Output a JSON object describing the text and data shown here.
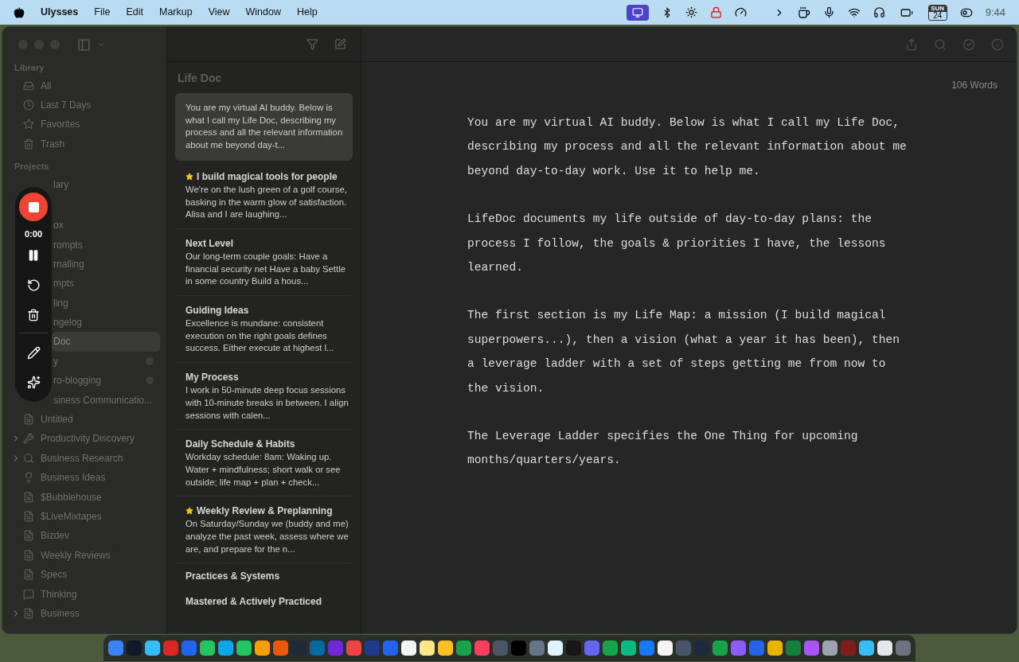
{
  "menu_bar": {
    "app": "Ulysses",
    "menus": [
      "File",
      "Edit",
      "Markup",
      "View",
      "Window",
      "Help"
    ],
    "calendar_day": "SUN",
    "calendar_date": "24",
    "clock": "9:44"
  },
  "sidebar": {
    "sections": [
      {
        "title": "Library",
        "items": [
          {
            "label": "All",
            "kind": "inbox",
            "selected": false
          },
          {
            "label": "Last 7 Days",
            "kind": "clock",
            "selected": false
          },
          {
            "label": "Favorites",
            "kind": "star",
            "selected": false
          },
          {
            "label": "Trash",
            "kind": "trash",
            "selected": false
          }
        ]
      },
      {
        "title": "Projects",
        "items": [
          {
            "label": "lary",
            "kind": "partial",
            "selected": false
          },
          {
            "label": "ox",
            "kind": "partial",
            "selected": false
          },
          {
            "label": "rompts",
            "kind": "partial",
            "selected": false
          },
          {
            "label": "rnalling",
            "kind": "partial",
            "selected": false
          },
          {
            "label": "mpts",
            "kind": "partial",
            "selected": false
          },
          {
            "label": "ling",
            "kind": "partial",
            "selected": false
          },
          {
            "label": "ngelog",
            "kind": "partial",
            "selected": false
          },
          {
            "label": "Doc",
            "kind": "partial",
            "selected": true
          },
          {
            "label": "y",
            "kind": "partial",
            "selected": false,
            "badge": true
          },
          {
            "label": "ro-blogging",
            "kind": "partial",
            "selected": false,
            "badge": true
          },
          {
            "label": "siness Communicatio...",
            "kind": "partial",
            "selected": false
          },
          {
            "label": "Untitled",
            "kind": "document",
            "selected": false
          },
          {
            "label": "Productivity Discovery",
            "kind": "tools",
            "selected": false,
            "expandable": true
          },
          {
            "label": "Business Research",
            "kind": "search",
            "selected": false,
            "expandable": true
          },
          {
            "label": "Business Ideas",
            "kind": "bulb",
            "selected": false
          },
          {
            "label": "$Bubblehouse",
            "kind": "document",
            "selected": false
          },
          {
            "label": "$LiveMixtapes",
            "kind": "document",
            "selected": false
          },
          {
            "label": "Bizdev",
            "kind": "document",
            "selected": false
          },
          {
            "label": "Weekly Reviews",
            "kind": "document",
            "selected": false
          },
          {
            "label": "Specs",
            "kind": "document",
            "selected": false
          },
          {
            "label": "Thinking",
            "kind": "chat",
            "selected": false
          },
          {
            "label": "Business",
            "kind": "document",
            "selected": false,
            "expandable": true
          }
        ]
      }
    ]
  },
  "recorder": {
    "time": "0:00"
  },
  "sheet_list": {
    "title": "Life Doc",
    "sheets": [
      {
        "starred": false,
        "selected": true,
        "preview": "You are my virtual AI buddy. Below is what I call my Life Doc, describing my process and all the relevant information about me beyond day-t..."
      },
      {
        "title": "I build magical tools for people",
        "starred": true,
        "selected": false,
        "preview": "We're on the lush green of a golf course, basking in the warm glow of satisfaction. Alisa and I are laughing..."
      },
      {
        "title": "Next Level",
        "starred": false,
        "selected": false,
        "preview": "Our long-term couple goals: Have a financial security net Have a baby Settle in some country Build a hous..."
      },
      {
        "title": "Guiding Ideas",
        "starred": false,
        "selected": false,
        "preview": "Excellence is mundane: consistent execution on the right goals defines success. Either execute at highest l..."
      },
      {
        "title": "My Process",
        "starred": false,
        "selected": false,
        "preview": "I work in 50-minute deep focus sessions with 10-minute breaks in between. I align sessions with calen..."
      },
      {
        "title": "Daily Schedule & Habits",
        "starred": false,
        "selected": false,
        "preview": "Workday schedule: 8am: Waking up. Water + mindfulness; short walk or see outside; life map + plan + check..."
      },
      {
        "title": "Weekly Review & Preplanning",
        "starred": true,
        "selected": false,
        "preview": "On Saturday/Sunday we (buddy and me) analyze the past week, assess where we are, and prepare for the n..."
      },
      {
        "title": "Practices & Systems",
        "starred": false,
        "selected": false
      },
      {
        "title": "Mastered & Actively Practiced",
        "starred": false,
        "selected": false
      }
    ]
  },
  "editor": {
    "word_count": "106 Words",
    "paragraphs": [
      "You are my virtual AI buddy. Below is what I call my Life Doc, describing my process and all the relevant information about me beyond day-to-day work. Use it to help me.",
      "LifeDoc documents my life outside of day-to-day plans: the process I follow, the goals & priorities I have, the lessons learned.",
      "The first section is my Life Map: a mission (I build magical superpowers...), then a vision (what a year it has been), then a leverage ladder with a set of steps getting me from now to the vision.",
      "The Leverage Ladder specifies the One Thing for upcoming months/quarters/years."
    ]
  },
  "dock": {
    "apps": [
      {
        "color": "#3b82f6"
      },
      {
        "color": "#111827"
      },
      {
        "color": "#38bdf8"
      },
      {
        "color": "#dc2626"
      },
      {
        "color": "#2563eb"
      },
      {
        "color": "#22c55e"
      },
      {
        "color": "#0ea5e9"
      },
      {
        "color": "#22c55e"
      },
      {
        "color": "#f59e0b"
      },
      {
        "color": "#ea580c"
      },
      {
        "color": "#1f2937"
      },
      {
        "color": "#0369a1"
      },
      {
        "color": "#6d28d9"
      },
      {
        "color": "#ef4444"
      },
      {
        "color": "#1e3a8a"
      },
      {
        "color": "#2563eb"
      },
      {
        "color": "#f3f4f6"
      },
      {
        "color": "#fde68a"
      },
      {
        "color": "#fbbf24"
      },
      {
        "color": "#16a34a"
      },
      {
        "color": "#f43f5e"
      },
      {
        "color": "#4b5563"
      },
      {
        "color": "#000000"
      },
      {
        "color": "#64748b"
      },
      {
        "color": "#e0f2fe"
      },
      {
        "color": "#171717"
      },
      {
        "color": "#6366f1"
      },
      {
        "color": "#16a34a"
      },
      {
        "color": "#10b981"
      },
      {
        "color": "#1877f2"
      },
      {
        "color": "#f5f5f4"
      },
      {
        "color": "#475569"
      },
      {
        "color": "#1e293b"
      },
      {
        "color": "#16a34a"
      },
      {
        "color": "#8b5cf6"
      },
      {
        "color": "#2563eb"
      },
      {
        "color": "#eab308"
      },
      {
        "color": "#15803d"
      },
      {
        "color": "#a855f7"
      },
      {
        "color": "#9ca3af"
      },
      {
        "color": "#7f1d1d"
      },
      {
        "color": "#38bdf8"
      },
      {
        "color": "#e5e7eb"
      },
      {
        "color": "#6b7280"
      }
    ]
  }
}
